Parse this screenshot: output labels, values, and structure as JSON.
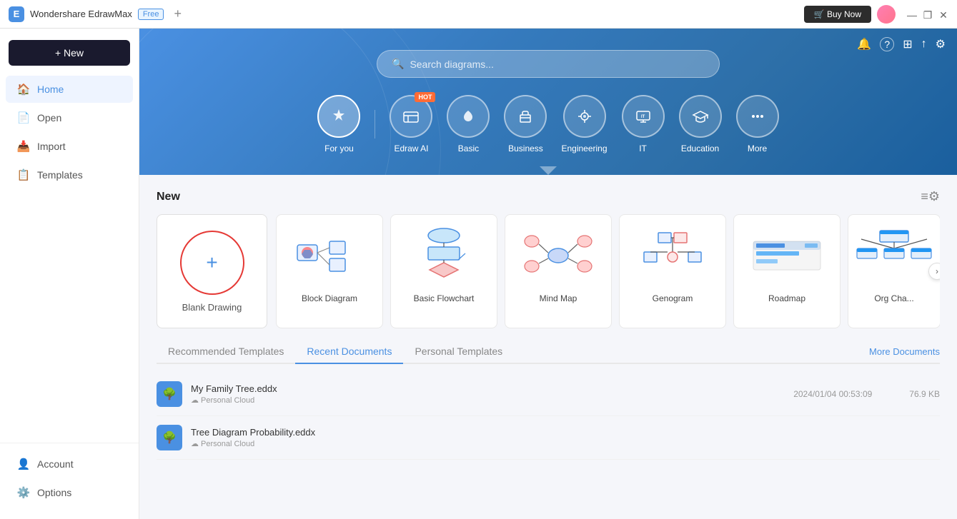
{
  "titleBar": {
    "appName": "Wondershare EdrawMax",
    "badge": "Free",
    "addTabLabel": "+",
    "buyNowLabel": "🛒 Buy Now",
    "windowControls": [
      "—",
      "❐",
      "✕"
    ]
  },
  "sidebar": {
    "newButton": "+ New",
    "items": [
      {
        "id": "home",
        "label": "Home",
        "icon": "🏠",
        "active": true
      },
      {
        "id": "open",
        "label": "Open",
        "icon": "📄"
      },
      {
        "id": "import",
        "label": "Import",
        "icon": "📥"
      },
      {
        "id": "templates",
        "label": "Templates",
        "icon": "📋"
      }
    ],
    "bottomItems": [
      {
        "id": "account",
        "label": "Account",
        "icon": "👤"
      },
      {
        "id": "options",
        "label": "Options",
        "icon": "⚙️"
      }
    ]
  },
  "hero": {
    "searchPlaceholder": "Search diagrams...",
    "categories": [
      {
        "id": "for-you",
        "label": "For you",
        "icon": "✦",
        "active": true,
        "hot": false
      },
      {
        "id": "edraw-ai",
        "label": "Edraw AI",
        "icon": "✦",
        "active": false,
        "hot": true
      },
      {
        "id": "basic",
        "label": "Basic",
        "icon": "🏷",
        "active": false,
        "hot": false
      },
      {
        "id": "business",
        "label": "Business",
        "icon": "💼",
        "active": false,
        "hot": false
      },
      {
        "id": "engineering",
        "label": "Engineering",
        "icon": "⛑",
        "active": false,
        "hot": false
      },
      {
        "id": "it",
        "label": "IT",
        "icon": "🖥",
        "active": false,
        "hot": false
      },
      {
        "id": "education",
        "label": "Education",
        "icon": "🎓",
        "active": false,
        "hot": false
      },
      {
        "id": "more",
        "label": "More",
        "icon": "⋯",
        "active": false,
        "hot": false
      }
    ],
    "hotLabel": "HOT"
  },
  "newSection": {
    "title": "New",
    "blankDrawing": "Blank Drawing",
    "templates": [
      {
        "id": "block-diagram",
        "name": "Block Diagram"
      },
      {
        "id": "basic-flowchart",
        "name": "Basic Flowchart"
      },
      {
        "id": "mind-map",
        "name": "Mind Map"
      },
      {
        "id": "genogram",
        "name": "Genogram"
      },
      {
        "id": "roadmap",
        "name": "Roadmap"
      },
      {
        "id": "org-chart",
        "name": "Org Cha..."
      }
    ]
  },
  "bottomSection": {
    "tabs": [
      {
        "id": "recommended",
        "label": "Recommended Templates",
        "active": false
      },
      {
        "id": "recent",
        "label": "Recent Documents",
        "active": true
      },
      {
        "id": "personal",
        "label": "Personal Templates",
        "active": false
      }
    ],
    "moreDocsLabel": "More Documents",
    "documents": [
      {
        "id": "family-tree",
        "name": "My Family Tree.eddx",
        "location": "Personal Cloud",
        "date": "2024/01/04 00:53:09",
        "size": "76.9 KB"
      },
      {
        "id": "tree-diagram",
        "name": "Tree Diagram Probability.eddx",
        "location": "Personal Cloud",
        "date": "",
        "size": ""
      }
    ]
  },
  "headerIcons": {
    "bell": "🔔",
    "help": "?",
    "apps": "⊞",
    "share": "↑",
    "settings": "⚙"
  }
}
